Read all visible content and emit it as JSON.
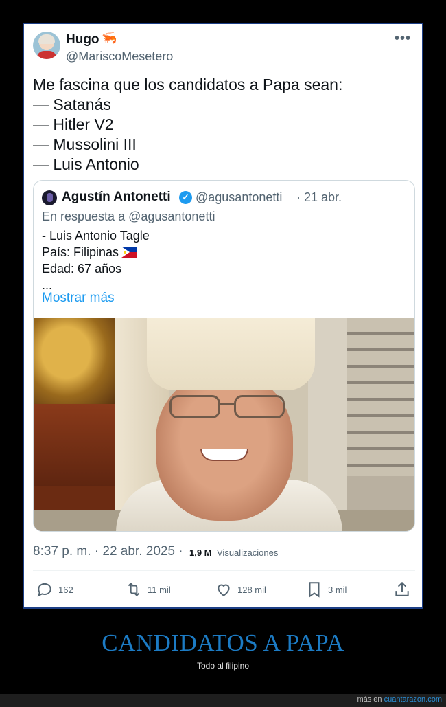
{
  "tweet": {
    "author_name": "Hugo",
    "author_emoji": "🦐",
    "author_handle": "@MariscoMesetero",
    "more_icon": "more-horizontal-icon",
    "lines": [
      "Me fascina que los candidatos a Papa sean:",
      "— Satanás",
      "— Hitler V2",
      "— Mussolini III",
      "— Luis Antonio"
    ],
    "timestamp": "8:37 p. m. · 22 abr. 2025 ·",
    "views_count": "1,9 M",
    "views_label": "Visualizaciones"
  },
  "quote": {
    "author_name": "Agustín Antonetti",
    "verified": "verified-badge-icon",
    "handle": "@agusantonetti",
    "date": "· 21 abr.",
    "reply_to": "En respuesta a @agusantonetti",
    "lines": [
      "- Luis Antonio Tagle",
      "País: Filipinas",
      "Edad: 67 años",
      "..."
    ],
    "show_more": "Mostrar más"
  },
  "actions": {
    "reply_count": "162",
    "retweet_count": "11 mil",
    "like_count": "128 mil",
    "bookmark_count": "3 mil"
  },
  "caption": {
    "title": "CANDIDATOS A PAPA",
    "subtitle": "Todo al filipino"
  },
  "footer": {
    "prefix": "más en",
    "site": "cuantarazon.com"
  },
  "colors": {
    "accent_blue": "#1d9bf0",
    "caption_blue": "#1c7bc4",
    "card_border": "#1d3f86"
  }
}
